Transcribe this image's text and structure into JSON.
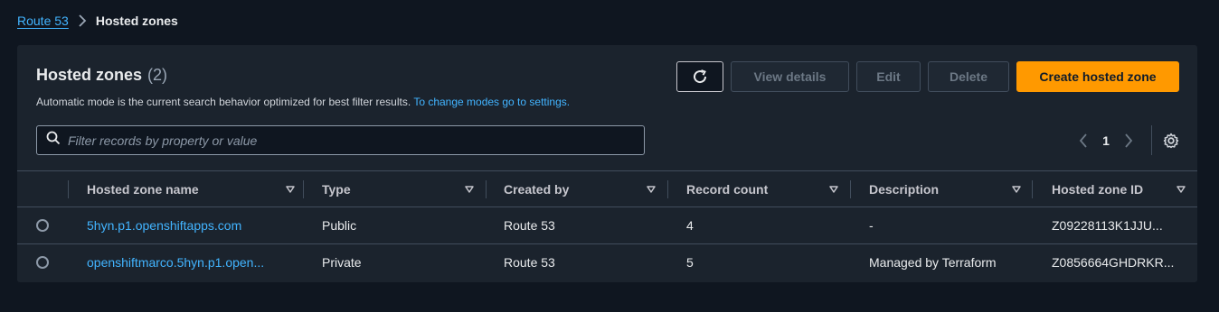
{
  "breadcrumb": {
    "parent": "Route 53",
    "current": "Hosted zones"
  },
  "header": {
    "title": "Hosted zones",
    "count": "(2)",
    "description": "Automatic mode is the current search behavior optimized for best filter results.",
    "description_link": "To change modes go to settings."
  },
  "actions": {
    "refresh_icon": "refresh-icon",
    "view_details": "View details",
    "edit": "Edit",
    "delete": "Delete",
    "create": "Create hosted zone"
  },
  "search": {
    "placeholder": "Filter records by property or value",
    "value": ""
  },
  "pagination": {
    "page": "1"
  },
  "table": {
    "columns": [
      "Hosted zone name",
      "Type",
      "Created by",
      "Record count",
      "Description",
      "Hosted zone ID"
    ],
    "rows": [
      {
        "name": "5hyn.p1.openshiftapps.com",
        "type": "Public",
        "created_by": "Route 53",
        "record_count": "4",
        "description": "-",
        "id": "Z09228113K1JJU..."
      },
      {
        "name": "openshiftmarco.5hyn.p1.open...",
        "type": "Private",
        "created_by": "Route 53",
        "record_count": "5",
        "description": "Managed by Terraform",
        "id": "Z0856664GHDRKR..."
      }
    ]
  },
  "colors": {
    "accent": "#ff9900",
    "link": "#42b4ff",
    "panel": "#1b232d",
    "background": "#0f1620"
  }
}
